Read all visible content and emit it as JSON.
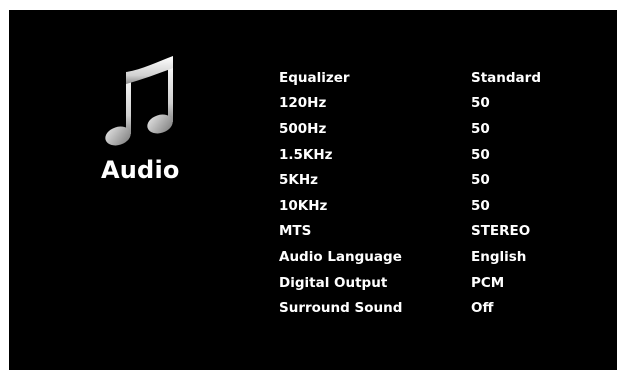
{
  "section": {
    "title": "Audio",
    "icon": "music-note-icon"
  },
  "settings": [
    {
      "label": "Equalizer",
      "value": "Standard"
    },
    {
      "label": "120Hz",
      "value": "50"
    },
    {
      "label": "500Hz",
      "value": "50"
    },
    {
      "label": "1.5KHz",
      "value": "50"
    },
    {
      "label": "5KHz",
      "value": "50"
    },
    {
      "label": "10KHz",
      "value": "50"
    },
    {
      "label": "MTS",
      "value": "STEREO"
    },
    {
      "label": "Audio Language",
      "value": "English"
    },
    {
      "label": "Digital Output",
      "value": "PCM"
    },
    {
      "label": "Surround Sound",
      "value": "Off"
    }
  ],
  "colors": {
    "background": "#000000",
    "text": "#ffffff",
    "icon_gradient_top": "#ffffff",
    "icon_gradient_bottom": "#8a8a8a"
  }
}
